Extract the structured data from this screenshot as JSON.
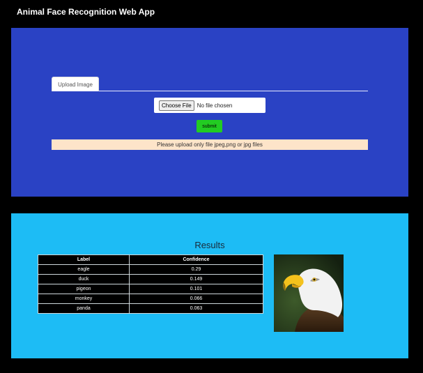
{
  "app": {
    "title": "Animal Face Recognition Web App"
  },
  "upload": {
    "tab_label": "Upload Image",
    "choose_file_label": "Choose File",
    "file_status": "No file chosen",
    "submit_label": "submit",
    "warning": "Please upload only file jpeg,png or jpg files"
  },
  "results": {
    "title": "Results",
    "columns": [
      "Label",
      "Confidence"
    ],
    "rows": [
      {
        "label": "eagle",
        "confidence": "0.29"
      },
      {
        "label": "duck",
        "confidence": "0.149"
      },
      {
        "label": "pigeon",
        "confidence": "0.101"
      },
      {
        "label": "monkey",
        "confidence": "0.066"
      },
      {
        "label": "panda",
        "confidence": "0.063"
      }
    ]
  },
  "colors": {
    "page_bg": "#000000",
    "upload_panel": "#2a42c4",
    "results_panel": "#1dbcf5",
    "submit": "#22cc22",
    "warning_bg": "#fde4c9"
  }
}
